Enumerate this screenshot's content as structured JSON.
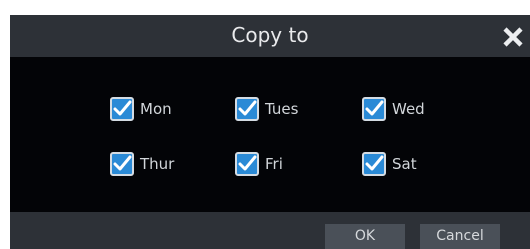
{
  "dialog": {
    "title": "Copy to",
    "close_icon": "close-icon"
  },
  "days": [
    {
      "label": "Mon",
      "checked": true
    },
    {
      "label": "Tues",
      "checked": true
    },
    {
      "label": "Wed",
      "checked": true
    },
    {
      "label": "Thur",
      "checked": true
    },
    {
      "label": "Fri",
      "checked": true
    },
    {
      "label": "Sat",
      "checked": true
    }
  ],
  "buttons": {
    "ok_label": "OK",
    "cancel_label": "Cancel"
  },
  "colors": {
    "title_bar": "#2d3137",
    "body_background": "#030407",
    "checkbox_fill": "#2a8ad6",
    "button_background": "#4a5058",
    "text": "#d2d6da"
  }
}
